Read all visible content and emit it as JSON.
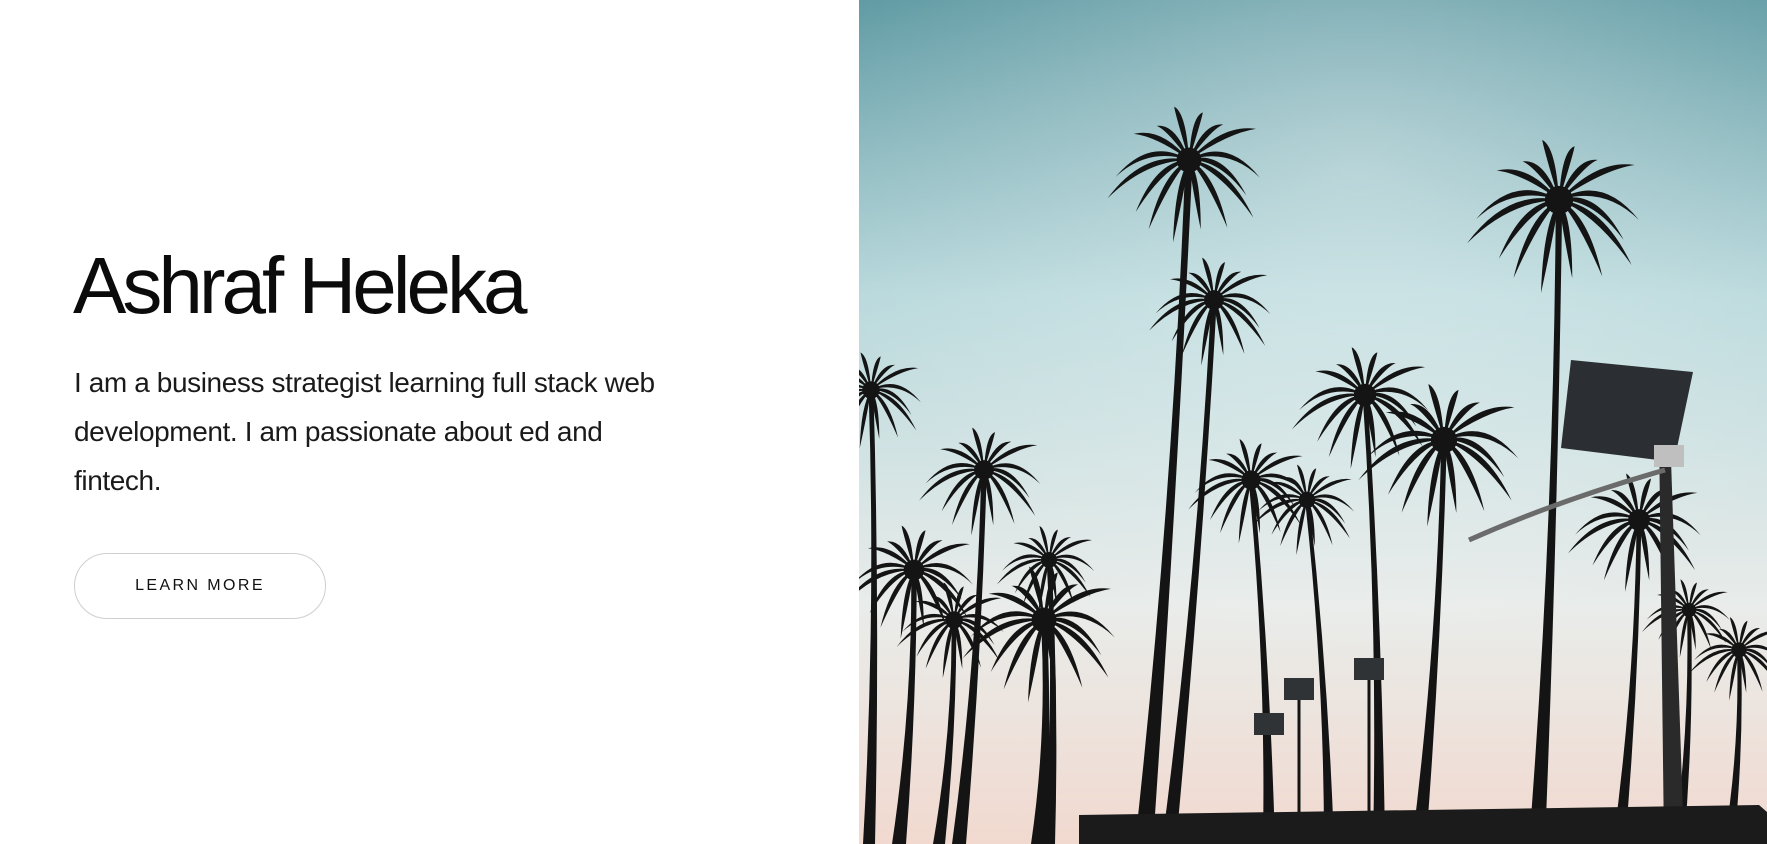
{
  "hero": {
    "title": "Ashraf Heleka",
    "bio": "I am a business strategist learning full stack web development. I am passionate about ed and fintech.",
    "cta_label": "LEARN MORE"
  },
  "image": {
    "subject": "palm-trees-photo",
    "colors": {
      "sky_top": "#5f9aa3",
      "sky_mid": "#b9d9dc",
      "sky_low": "#e9ecea",
      "sky_horizon": "#f1d9cf",
      "silhouette": "#141414"
    }
  }
}
